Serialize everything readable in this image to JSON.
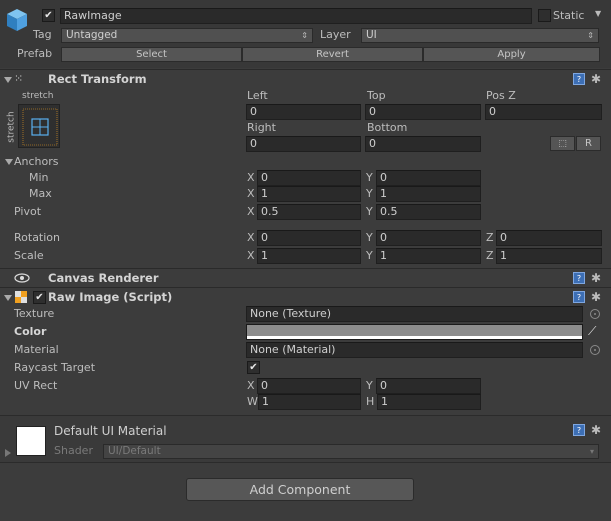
{
  "gameobject": {
    "name": "RawImage",
    "active": true,
    "static_label": "Static",
    "static_checked": false,
    "tag_label": "Tag",
    "tag_value": "Untagged",
    "layer_label": "Layer",
    "layer_value": "UI",
    "prefab_label": "Prefab",
    "prefab_buttons": [
      "Select",
      "Revert",
      "Apply"
    ]
  },
  "rect_transform": {
    "title": "Rect Transform",
    "anchor_horizontal_label": "stretch",
    "anchor_vertical_label": "stretch",
    "col_labels_row1": [
      "Left",
      "Top",
      "Pos Z"
    ],
    "values_row1": [
      "0",
      "0",
      "0"
    ],
    "col_labels_row2": [
      "Right",
      "Bottom"
    ],
    "values_row2": [
      "0",
      "0"
    ],
    "r_button": "R",
    "anchors_label": "Anchors",
    "min_label": "Min",
    "min_x": "0",
    "min_y": "0",
    "max_label": "Max",
    "max_x": "1",
    "max_y": "1",
    "pivot_label": "Pivot",
    "pivot_x": "0.5",
    "pivot_y": "0.5",
    "rotation_label": "Rotation",
    "rotation": {
      "x": "0",
      "y": "0",
      "z": "0"
    },
    "scale_label": "Scale",
    "scale": {
      "x": "1",
      "y": "1",
      "z": "1"
    },
    "axis_x": "X",
    "axis_y": "Y",
    "axis_z": "Z"
  },
  "canvas_renderer": {
    "title": "Canvas Renderer"
  },
  "raw_image": {
    "title": "Raw Image (Script)",
    "enabled": true,
    "texture_label": "Texture",
    "texture_value": "None (Texture)",
    "color_label": "Color",
    "color_value": "#8c8c8c",
    "material_label": "Material",
    "material_value": "None (Material)",
    "raycast_label": "Raycast Target",
    "raycast_checked": true,
    "uvrect_label": "UV Rect",
    "uv_x_label": "X",
    "uv_x": "0",
    "uv_y_label": "Y",
    "uv_y": "0",
    "uv_w_label": "W",
    "uv_w": "1",
    "uv_h_label": "H",
    "uv_h": "1"
  },
  "material": {
    "name": "Default UI Material",
    "shader_label": "Shader",
    "shader_value": "UI/Default"
  },
  "add_component_label": "Add Component"
}
